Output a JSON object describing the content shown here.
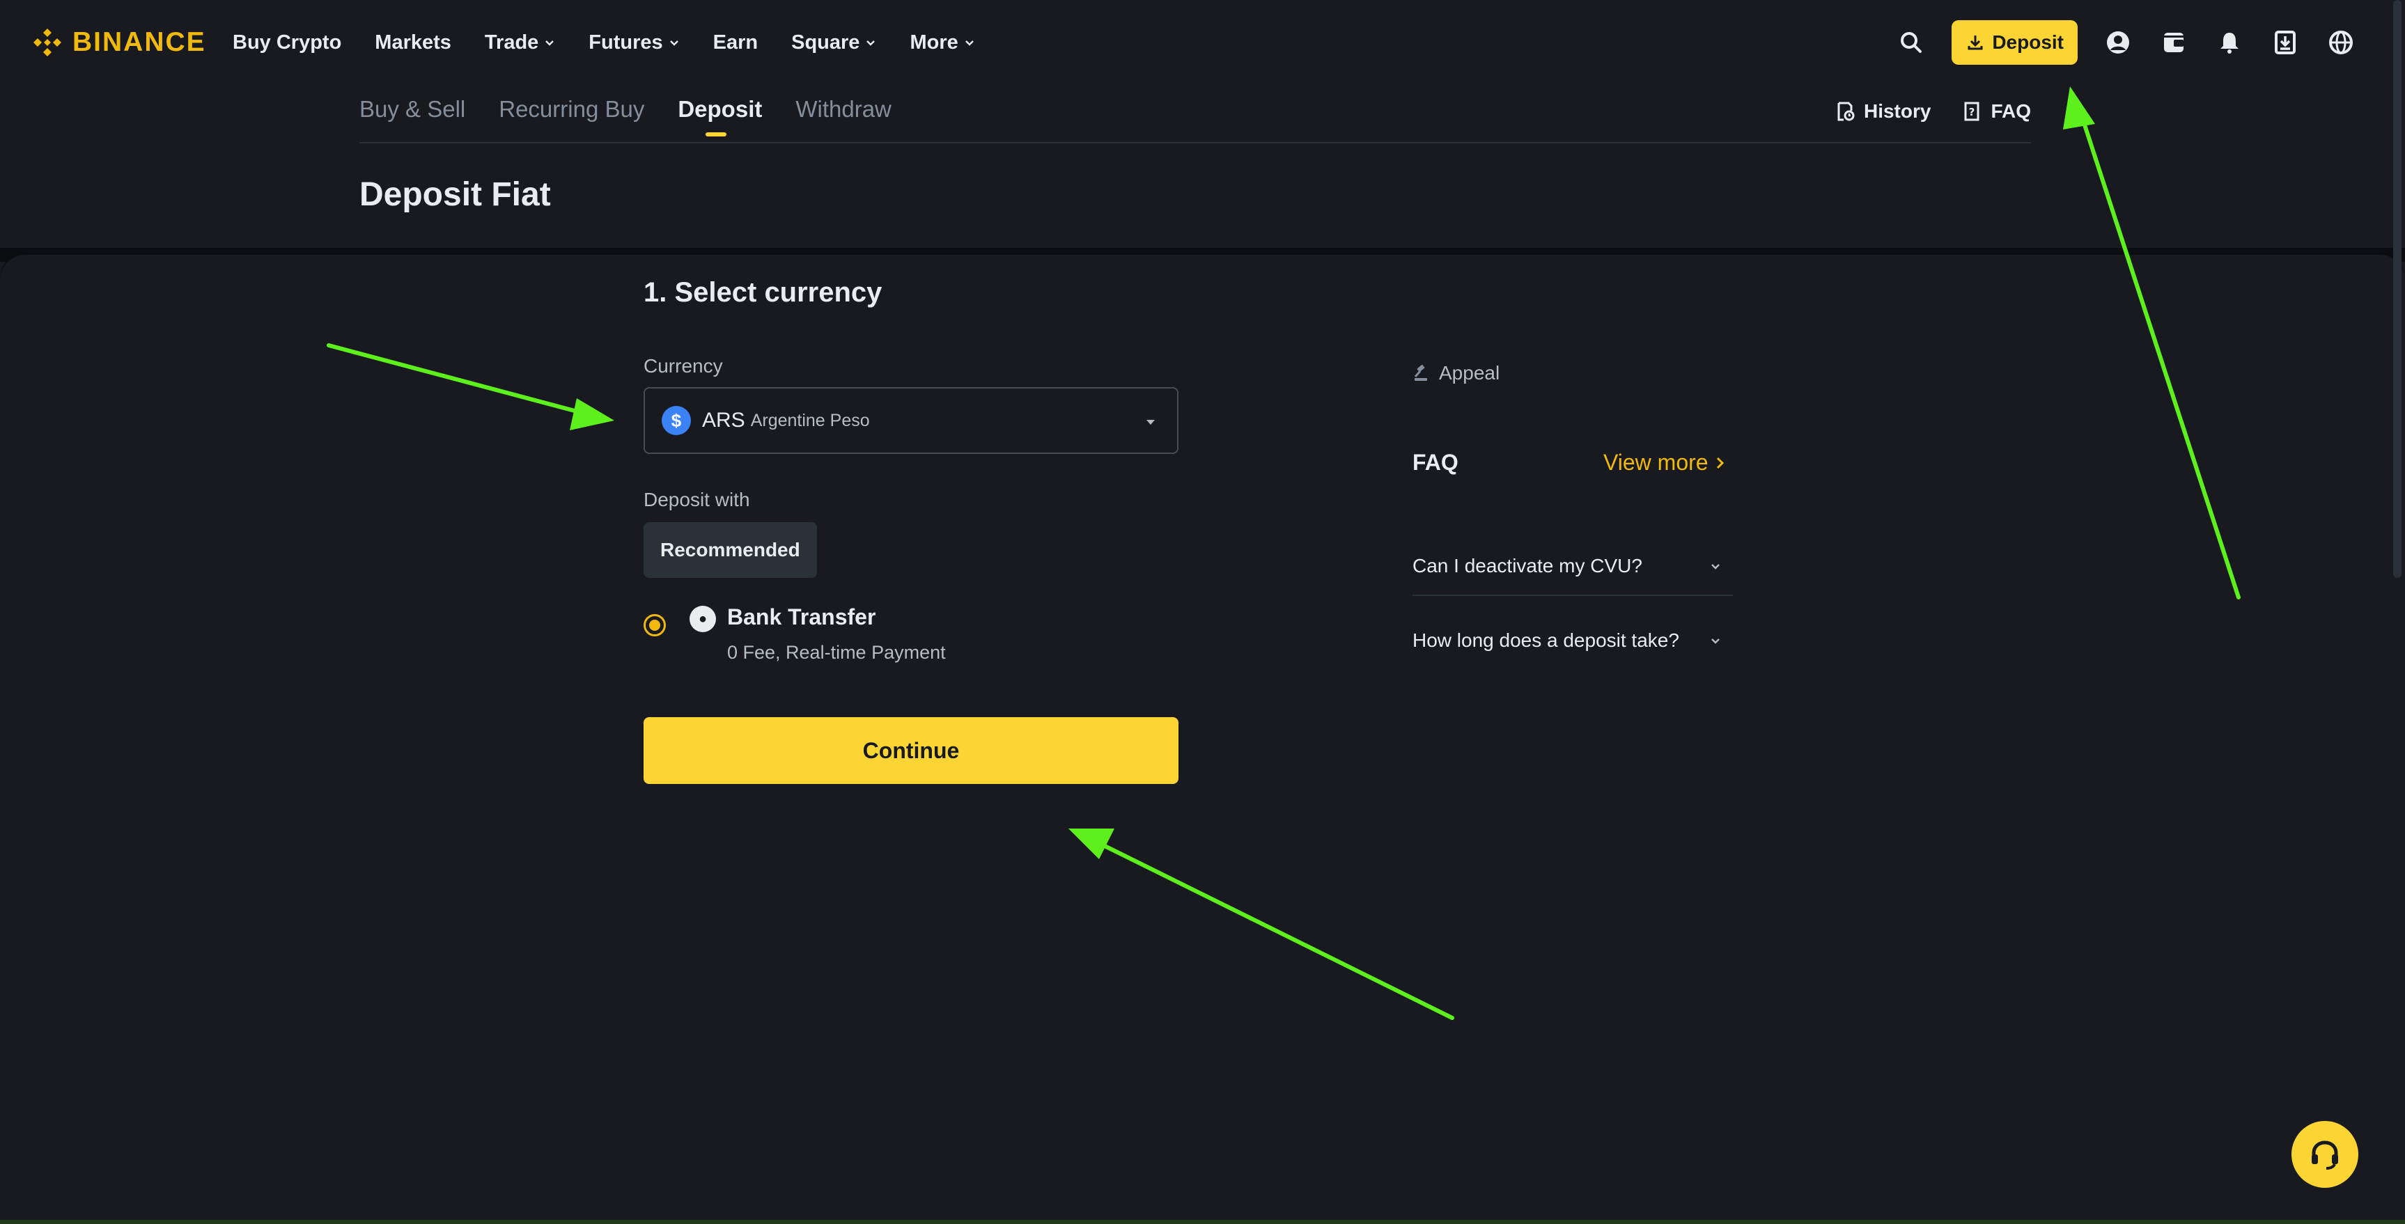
{
  "brand": {
    "logo_text": "BINANCE",
    "accent": "#fcd535",
    "background": "#181a20"
  },
  "nav": {
    "items": [
      {
        "label": "Buy Crypto",
        "has_dropdown": false
      },
      {
        "label": "Markets",
        "has_dropdown": false
      },
      {
        "label": "Trade",
        "has_dropdown": true
      },
      {
        "label": "Futures",
        "has_dropdown": true
      },
      {
        "label": "Earn",
        "has_dropdown": false
      },
      {
        "label": "Square",
        "has_dropdown": true
      },
      {
        "label": "More",
        "has_dropdown": true
      }
    ],
    "deposit_label": "Deposit",
    "icons": [
      "search-icon",
      "download-icon",
      "user-icon",
      "wallet-icon",
      "bell-icon",
      "download-app-icon",
      "globe-icon"
    ]
  },
  "subnav": {
    "tabs": [
      "Buy & Sell",
      "Recurring Buy",
      "Deposit",
      "Withdraw"
    ],
    "active_tab": "Deposit",
    "history_label": "History",
    "faq_label": "FAQ"
  },
  "page": {
    "title": "Deposit Fiat"
  },
  "form": {
    "step_title": "1. Select currency",
    "currency_label": "Currency",
    "currency": {
      "code": "ARS",
      "name": "Argentine Peso",
      "symbol": "$"
    },
    "deposit_with_label": "Deposit with",
    "recommended_label": "Recommended",
    "method": {
      "title": "Bank Transfer",
      "subtitle": "0 Fee, Real-time Payment",
      "selected": true
    },
    "continue_label": "Continue"
  },
  "sidebar": {
    "appeal_label": "Appeal",
    "faq_title": "FAQ",
    "view_more_label": "View more",
    "faq_items": [
      "Can I deactivate my CVU?",
      "How long does a deposit take?"
    ]
  },
  "annotation": {
    "arrow_color": "#5ef01c"
  }
}
